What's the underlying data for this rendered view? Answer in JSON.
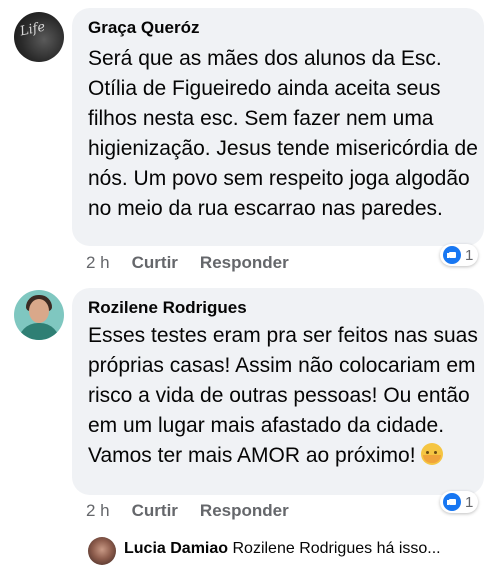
{
  "comments": [
    {
      "author": "Graça Queróz",
      "text": "Será que as mães dos alunos da Esc. Otília de Figueiredo ainda aceita seus filhos nesta esc. Sem fazer nem uma higienização. Jesus tende misericórdia de nós. Um povo sem respeito joga algodão no meio da rua escarrao nas paredes.",
      "time": "2 h",
      "like_label": "Curtir",
      "reply_label": "Responder",
      "reaction_count": "1",
      "reaction_icon": "like-icon",
      "avatar_text": "Life"
    },
    {
      "author": "Rozilene Rodrigues",
      "text": "Esses testes eram pra ser feitos nas suas próprias casas! Assim não colocariam em risco a vida de outras pessoas! Ou então em um lugar mais afastado da cidade. Vamos ter mais AMOR ao próximo! ",
      "emoji": "hugging-face-emoji",
      "time": "2 h",
      "like_label": "Curtir",
      "reply_label": "Responder",
      "reaction_count": "1",
      "reaction_icon": "like-icon"
    }
  ],
  "reply": {
    "author": "Lucia Damiao",
    "tag": "Rozilene Rodrigues",
    "text": "há isso..."
  },
  "colors": {
    "bubble": "#f0f2f5",
    "meta_text": "#65676b",
    "like_blue": "#1877f2"
  }
}
